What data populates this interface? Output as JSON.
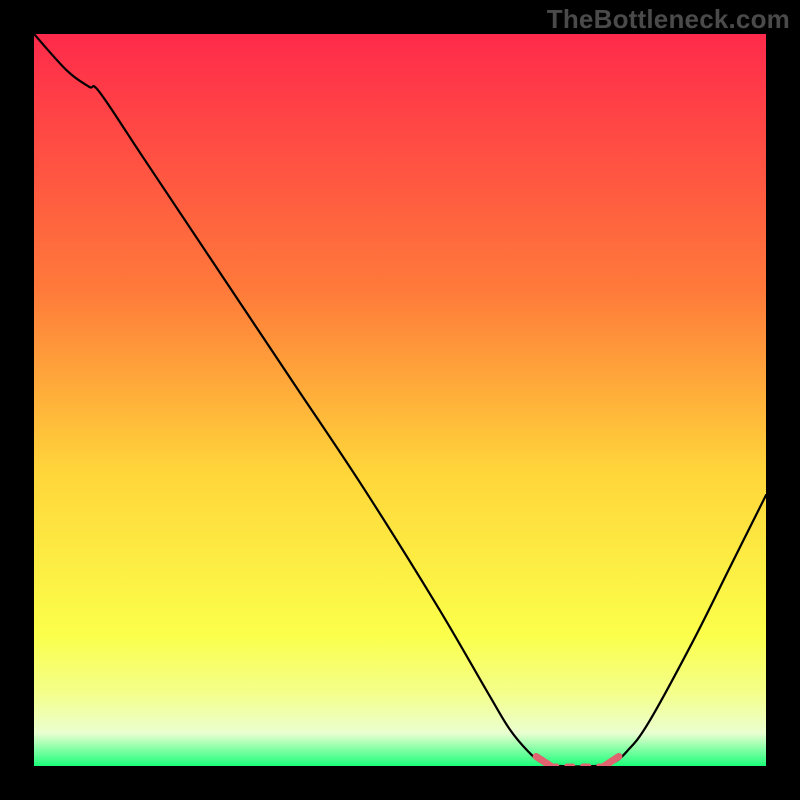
{
  "watermark": "TheBottleneck.com",
  "chart_data": {
    "type": "line",
    "title": "",
    "xlabel": "",
    "ylabel": "",
    "xlim": [
      0,
      100
    ],
    "ylim": [
      0,
      100
    ],
    "gradient_stops": [
      {
        "offset": 0.0,
        "color": "#ff2a4b"
      },
      {
        "offset": 0.35,
        "color": "#ff7a3a"
      },
      {
        "offset": 0.6,
        "color": "#ffd63a"
      },
      {
        "offset": 0.82,
        "color": "#fbff4a"
      },
      {
        "offset": 0.9,
        "color": "#f4ff8a"
      },
      {
        "offset": 0.955,
        "color": "#eaffd0"
      },
      {
        "offset": 1.0,
        "color": "#1bff7a"
      }
    ],
    "series": [
      {
        "name": "bottleneck-curve",
        "points": [
          [
            0.0,
            100.0
          ],
          [
            4.5,
            95.0
          ],
          [
            7.5,
            92.8
          ],
          [
            9.0,
            92.0
          ],
          [
            15.0,
            83.0
          ],
          [
            25.0,
            68.0
          ],
          [
            35.0,
            53.0
          ],
          [
            45.0,
            38.0
          ],
          [
            55.0,
            22.0
          ],
          [
            62.0,
            10.0
          ],
          [
            65.0,
            5.0
          ],
          [
            67.5,
            2.0
          ],
          [
            69.5,
            0.4
          ],
          [
            72.0,
            0.0
          ],
          [
            76.5,
            0.0
          ],
          [
            79.0,
            0.4
          ],
          [
            81.0,
            2.0
          ],
          [
            84.0,
            6.0
          ],
          [
            90.0,
            17.0
          ],
          [
            95.0,
            27.0
          ],
          [
            100.0,
            37.0
          ]
        ]
      },
      {
        "name": "flat-minimum-marks",
        "segments": [
          {
            "x1": 68.6,
            "y1": 1.3,
            "x2": 70.6,
            "y2": 0.0
          },
          {
            "x1": 77.9,
            "y1": 0.0,
            "x2": 79.9,
            "y2": 1.3
          }
        ]
      }
    ],
    "accent_color": "#e0636f",
    "curve_color": "#000000"
  }
}
